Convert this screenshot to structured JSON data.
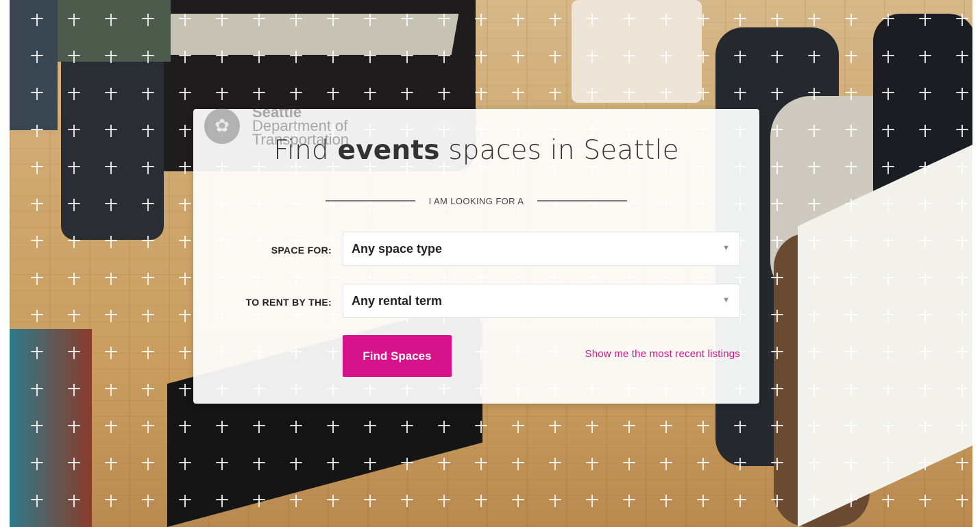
{
  "brand": {
    "logo_lines": [
      "Seattle",
      "Department of",
      "Transportation"
    ],
    "accent_color": "#d6138a"
  },
  "hero": {
    "title_prefix": "Find ",
    "title_highlight": "events",
    "title_suffix": " spaces in Seattle",
    "subtitle": "I AM LOOKING FOR A"
  },
  "form": {
    "space_for_label": "SPACE FOR:",
    "space_for_value": "Any space type",
    "rent_by_label": "TO RENT BY THE:",
    "rent_by_value": "Any rental term",
    "submit_label": "Find Spaces",
    "recent_link": "Show me the most recent listings"
  },
  "icons": {
    "dropdown": "chevron-down-icon",
    "seal": "city-seal-icon",
    "background_pattern": "plus-pattern"
  }
}
